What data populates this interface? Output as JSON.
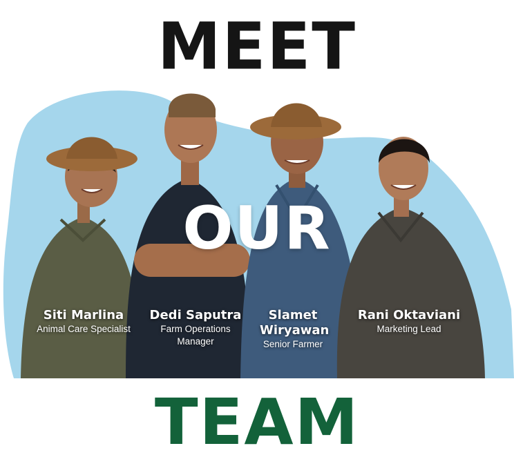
{
  "heading": {
    "top": "MEET",
    "middle": "OUR",
    "bottom": "TEAM"
  },
  "team": [
    {
      "name": "Siti Marlina",
      "role": "Animal Care Specialist"
    },
    {
      "name": "Dedi Saputra",
      "role": "Farm Operations Manager"
    },
    {
      "name": "Slamet Wiryawan",
      "role": "Senior Farmer"
    },
    {
      "name": "Rani Oktaviani",
      "role": "Marketing Lead"
    }
  ],
  "colors": {
    "top_heading": "#151515",
    "bottom_heading": "#13623a",
    "blob": "#a5d6ec",
    "label_text": "#ffffff"
  },
  "icons": [
    "team-photo-illustration"
  ]
}
